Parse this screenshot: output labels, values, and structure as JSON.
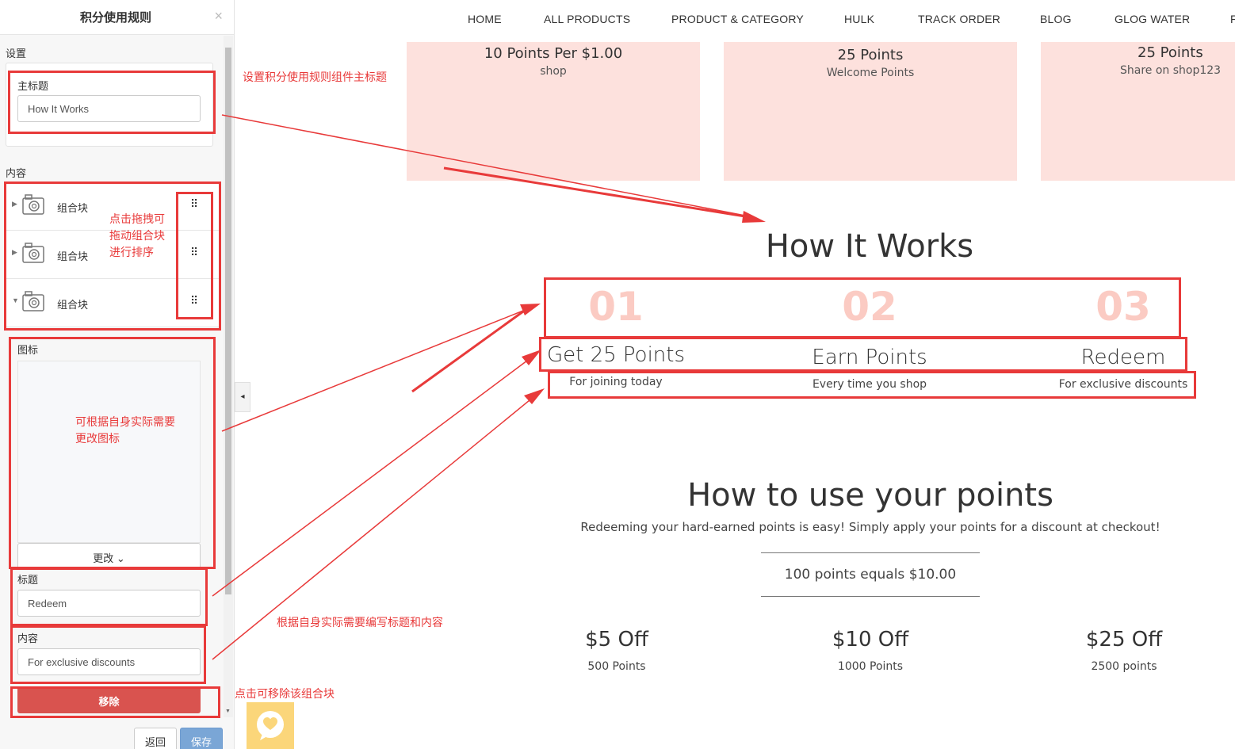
{
  "panel": {
    "title": "积分使用规则",
    "close": "×",
    "settings_label": "设置",
    "main_title_label": "主标题",
    "main_title_value": "How It Works",
    "content_label": "内容",
    "blocks": [
      {
        "label": "组合块",
        "drag": "⠿",
        "caret": "▶"
      },
      {
        "label": "组合块",
        "drag": "⠿",
        "caret": "▶"
      },
      {
        "label": "组合块",
        "drag": "⠿",
        "caret": "▼"
      }
    ],
    "icon_label": "图标",
    "change_label": "更改 ⌄",
    "title_label": "标题",
    "title_value": "Redeem",
    "content_field_label": "内容",
    "content_value": "For exclusive discounts",
    "remove_label": "移除",
    "back_label": "返回",
    "save_label": "保存",
    "collapse_label": "◂"
  },
  "nav": [
    "HOME",
    "ALL PRODUCTS",
    "PRODUCT & CATEGORY",
    "HULK",
    "TRACK ORDER",
    "BLOG",
    "GLOG WATER",
    "F"
  ],
  "tiles": [
    {
      "title": "10 Points Per $1.00",
      "sub": "shop"
    },
    {
      "title": "25 Points",
      "sub": "Welcome Points"
    },
    {
      "title": "25 Points",
      "sub": "Share on shop123"
    }
  ],
  "how": {
    "heading": "How It Works",
    "steps": [
      {
        "num": "01",
        "title": "Get 25 Points",
        "desc": "For joining today"
      },
      {
        "num": "02",
        "title": "Earn Points",
        "desc": "Every time you shop"
      },
      {
        "num": "03",
        "title": "Redeem",
        "desc": "For exclusive discounts"
      }
    ]
  },
  "use": {
    "heading": "How to use your points",
    "subtitle": "Redeeming your hard-earned points is easy! Simply apply your points for a discount at checkout!",
    "ratio": "100 points equals $10.00",
    "offers": [
      {
        "title": "$5 Off",
        "sub": "500 Points"
      },
      {
        "title": "$10 Off",
        "sub": "1000 Points"
      },
      {
        "title": "$25 Off",
        "sub": "2500 points"
      }
    ]
  },
  "annotations": {
    "title_note": "设置积分使用规则组件主标题",
    "drag_note": "点击拖拽可\n拖动组合块\n进行排序",
    "icon_note": "可根据自身实际需要\n更改图标",
    "edit_note": "根据自身实际需要编写标题和内容",
    "remove_note": "点击可移除该组合块"
  },
  "colors": {
    "accent_red": "#e83a3a",
    "step_pink": "#fbcbc3",
    "tile_pink": "#fde1dd",
    "remove_red": "#d9534f",
    "save_blue": "#7aa6d6",
    "chat_yellow": "#fbd67a"
  }
}
